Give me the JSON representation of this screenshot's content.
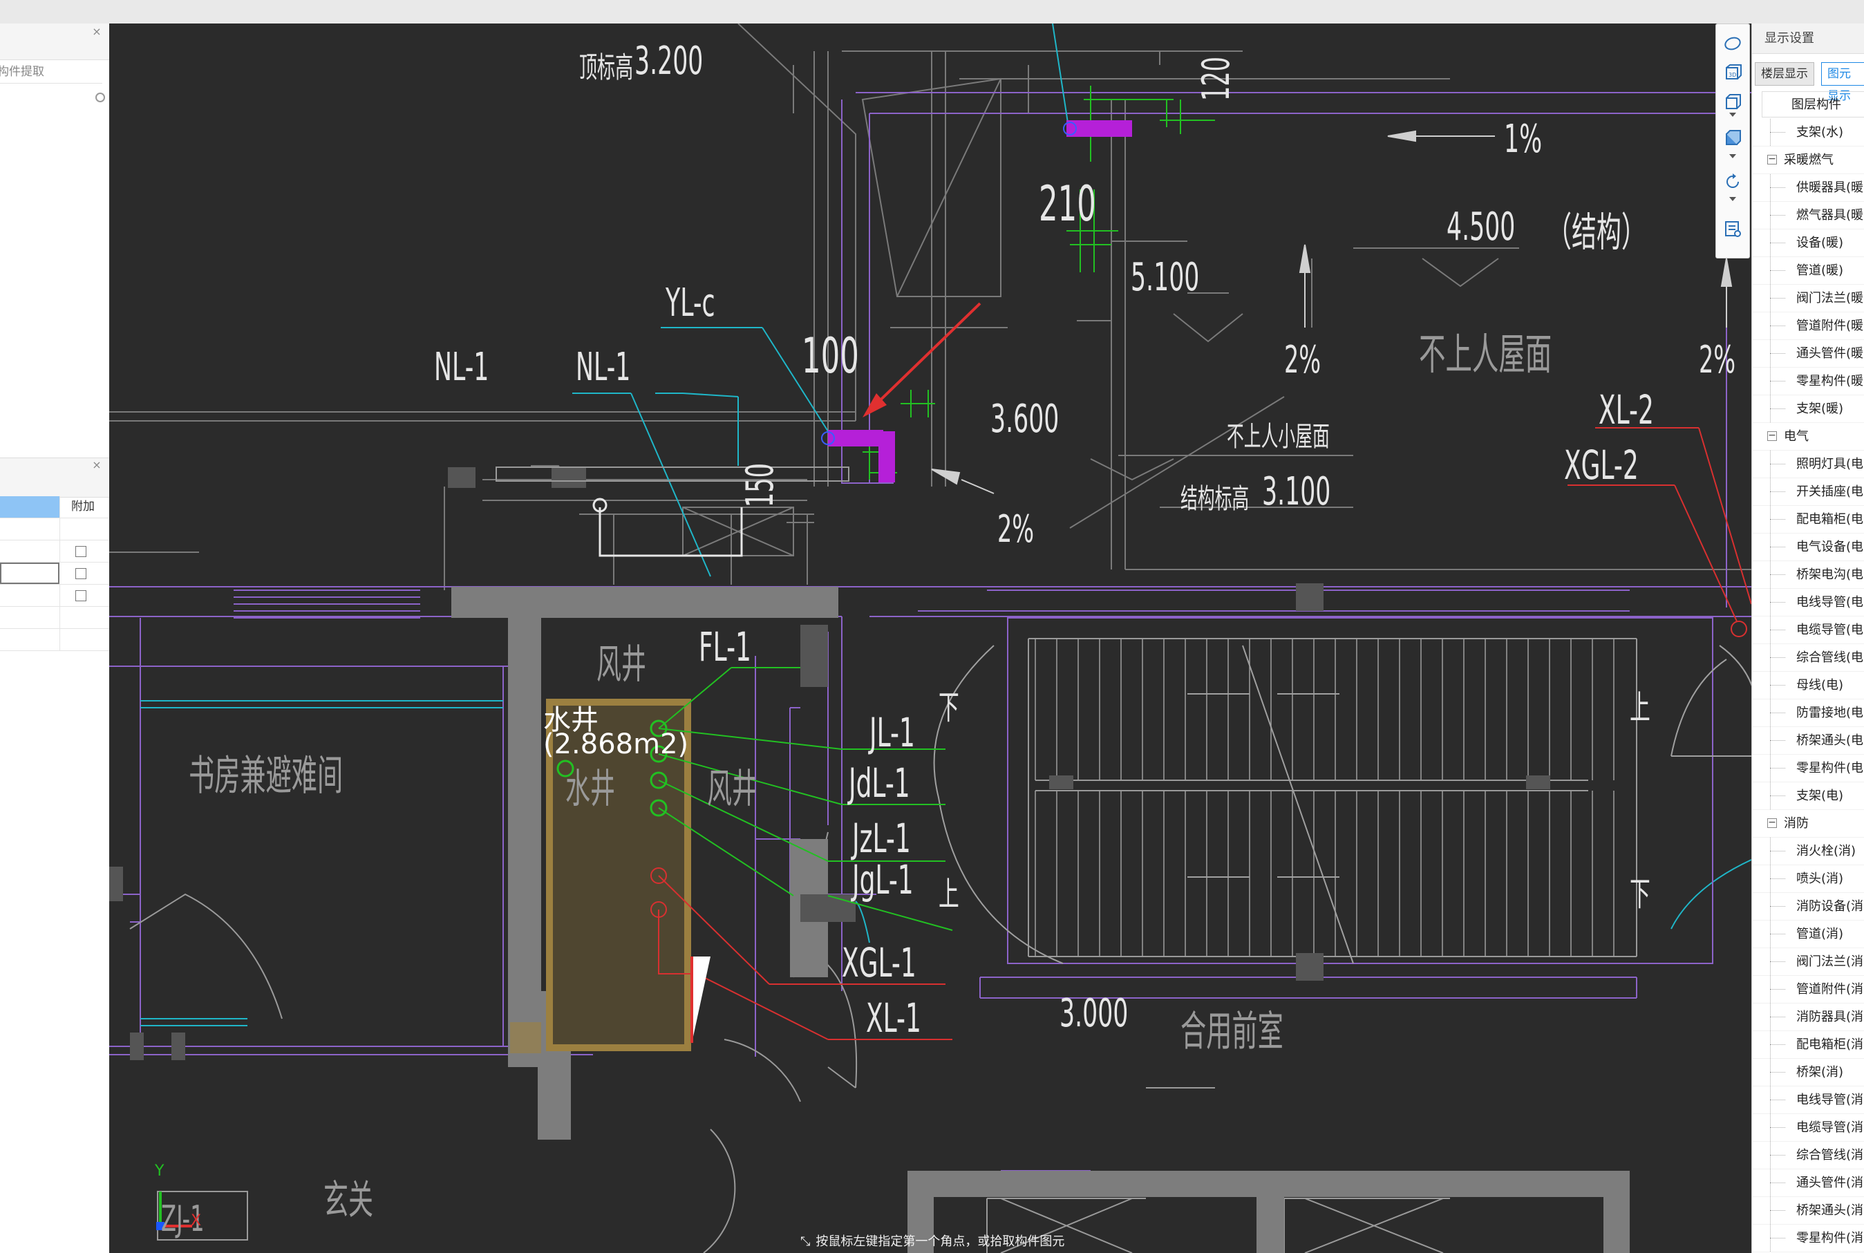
{
  "left_panel": {
    "search_placeholder": "构件提取",
    "table_header_col2": "附加"
  },
  "drawing": {
    "labels": {
      "top_elev_label": "顶标高",
      "top_elev_value": "3.200",
      "slope_1pct": "1%",
      "dim_120": "120",
      "dim_210": "210",
      "elev_4500": "4.500",
      "structure_note": "（结构）",
      "elev_5100": "5.100",
      "yl_c": "YL-c",
      "dim_100": "100",
      "nl1_a": "NL-1",
      "nl1_b": "NL-1",
      "dim_150": "150",
      "elev_3600": "3.600",
      "slope_2pct_a": "2%",
      "slope_2pct_b": "2%",
      "slope_2pct_c": "2%",
      "roof_nonaccess": "不上人屋面",
      "roof_small": "不上人小屋面",
      "struct_elev_label": "结构标高",
      "struct_elev_value": "3.100",
      "xl2": "XL-2",
      "xgl2": "XGL-2",
      "fl1": "FL-1",
      "air_shaft_a": "风井",
      "air_shaft_b": "风井",
      "water_shaft_label": "水井",
      "water_shaft_area": "(2.868m2)",
      "water_shaft_ghost": "水井",
      "study_room": "书房兼避难间",
      "jl1": "JL-1",
      "jdl1": "JdL-1",
      "jzl1": "JzL-1",
      "jgl1": "JgL-1",
      "xgl1": "XGL-1",
      "xl1": "XL-1",
      "stair_down_a": "下",
      "stair_up_a": "上",
      "stair_up_b": "上",
      "stair_down_b": "下",
      "elev_3000": "3.000",
      "front_room": "合用前室",
      "entrance": "玄关",
      "zj1": "ZJ-1",
      "axis_x": "X",
      "axis_y": "Y"
    },
    "status_text": "按鼠标左键指定第一个角点，或拾取构件图元",
    "colors": {
      "background": "#2b2b2b",
      "purple_line": "#8c63c9",
      "green_line": "#22c022",
      "cyan_line": "#1fb6c8",
      "red_line": "#d83030",
      "magenta_pipe": "#b520d8",
      "gray_wall": "#7d7d7d",
      "shaft_fill": "#4f4630",
      "shaft_border": "#9c8040"
    }
  },
  "view_tools": [
    "free-view-icon",
    "3d-icon",
    "box-view-icon",
    "solid-box-icon",
    "rotate-icon",
    "list-settings-icon"
  ],
  "right_panel": {
    "title": "显示设置",
    "tabs": [
      "楼层显示",
      "图元显示"
    ],
    "header": "图层构件",
    "items": [
      {
        "label": "支架(水)",
        "type": "child"
      },
      {
        "label": "采暖燃气",
        "type": "group"
      },
      {
        "label": "供暖器具(暖",
        "type": "child"
      },
      {
        "label": "燃气器具(暖",
        "type": "child"
      },
      {
        "label": "设备(暖)",
        "type": "child"
      },
      {
        "label": "管道(暖)",
        "type": "child"
      },
      {
        "label": "阀门法兰(暖",
        "type": "child"
      },
      {
        "label": "管道附件(暖",
        "type": "child"
      },
      {
        "label": "通头管件(暖",
        "type": "child"
      },
      {
        "label": "零星构件(暖",
        "type": "child"
      },
      {
        "label": "支架(暖)",
        "type": "child"
      },
      {
        "label": "电气",
        "type": "group"
      },
      {
        "label": "照明灯具(电",
        "type": "child"
      },
      {
        "label": "开关插座(电",
        "type": "child"
      },
      {
        "label": "配电箱柜(电",
        "type": "child"
      },
      {
        "label": "电气设备(电",
        "type": "child"
      },
      {
        "label": "桥架电沟(电",
        "type": "child"
      },
      {
        "label": "电线导管(电",
        "type": "child"
      },
      {
        "label": "电缆导管(电",
        "type": "child"
      },
      {
        "label": "综合管线(电",
        "type": "child"
      },
      {
        "label": "母线(电)",
        "type": "child"
      },
      {
        "label": "防雷接地(电",
        "type": "child"
      },
      {
        "label": "桥架通头(电",
        "type": "child"
      },
      {
        "label": "零星构件(电",
        "type": "child"
      },
      {
        "label": "支架(电)",
        "type": "child"
      },
      {
        "label": "消防",
        "type": "group"
      },
      {
        "label": "消火栓(消)",
        "type": "child"
      },
      {
        "label": "喷头(消)",
        "type": "child"
      },
      {
        "label": "消防设备(消",
        "type": "child"
      },
      {
        "label": "管道(消)",
        "type": "child"
      },
      {
        "label": "阀门法兰(消",
        "type": "child"
      },
      {
        "label": "管道附件(消",
        "type": "child"
      },
      {
        "label": "消防器具(消",
        "type": "child"
      },
      {
        "label": "配电箱柜(消",
        "type": "child"
      },
      {
        "label": "桥架(消)",
        "type": "child"
      },
      {
        "label": "电线导管(消",
        "type": "child"
      },
      {
        "label": "电缆导管(消",
        "type": "child"
      },
      {
        "label": "综合管线(消",
        "type": "child"
      },
      {
        "label": "通头管件(消",
        "type": "child"
      },
      {
        "label": "桥架通头(消",
        "type": "child"
      },
      {
        "label": "零星构件(消",
        "type": "child"
      }
    ]
  }
}
